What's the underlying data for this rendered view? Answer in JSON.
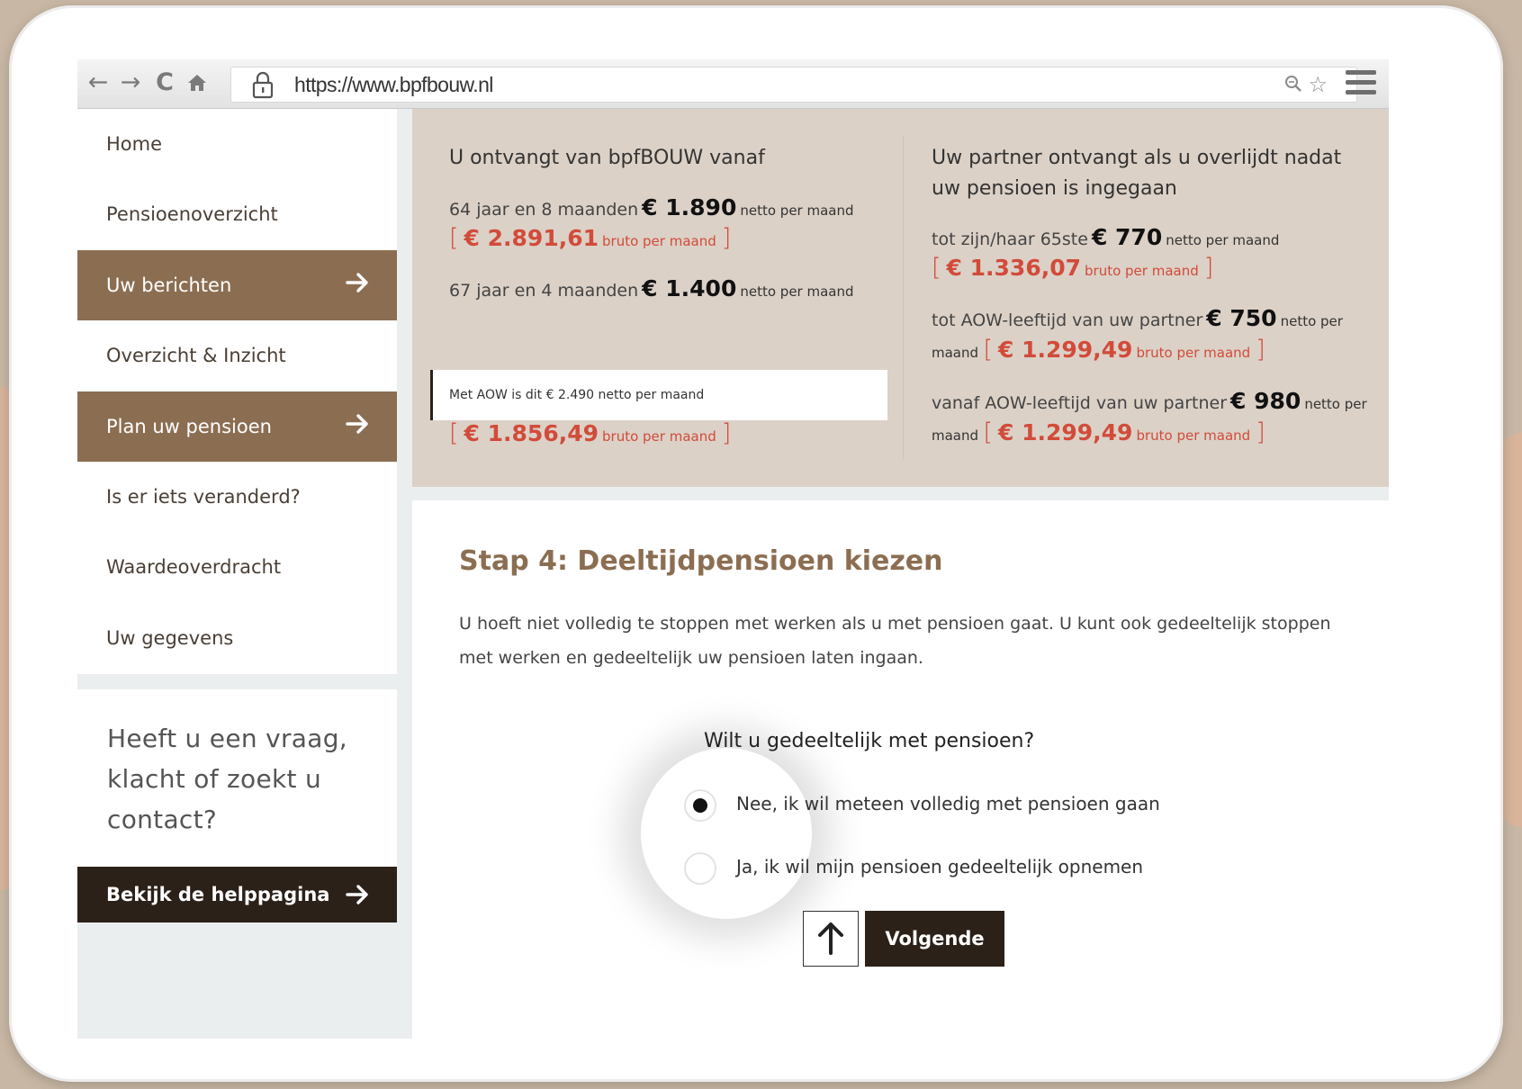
{
  "browser": {
    "url": "https://www.bpfbouw.nl"
  },
  "sidebar": {
    "items": [
      {
        "label": "Home",
        "active": false
      },
      {
        "label": "Pensioenoverzicht",
        "active": false
      },
      {
        "label": "Uw berichten",
        "active": true
      },
      {
        "label": "Overzicht & Inzicht",
        "active": false
      },
      {
        "label": "Plan uw pensioen",
        "active": true
      },
      {
        "label": "Is er iets veranderd?",
        "active": false
      },
      {
        "label": "Waardeoverdracht",
        "active": false
      },
      {
        "label": "Uw gegevens",
        "active": false
      }
    ],
    "help": {
      "text": "Heeft u een vraag, klacht of zoekt u contact?",
      "button_label": "Bekijk de helppagina"
    }
  },
  "summary": {
    "left": {
      "title": "U ontvangt van bpfBOUW vanaf",
      "row1": {
        "prefix": "64 jaar en 8 maanden",
        "amount": "€ 1.890",
        "suffix": "netto per maand",
        "bruto": "€ 2.891,61",
        "bruto_suffix": "bruto per maand"
      },
      "row2": {
        "prefix": "67 jaar en 4 maanden",
        "amount": "€ 1.400",
        "suffix": "netto per maand"
      },
      "aow_note": "Met AOW is dit  € 2.490 netto per maand",
      "row2_bruto": {
        "bruto": "€ 1.856,49",
        "bruto_suffix": "bruto per maand"
      }
    },
    "right": {
      "title": "Uw partner ontvangt als u overlijdt nadat uw pensioen is ingegaan",
      "row1": {
        "prefix": "tot zijn/haar 65ste",
        "amount": "€ 770",
        "suffix": "netto per maand",
        "bruto": "€ 1.336,07",
        "bruto_suffix": "bruto per maand"
      },
      "row2": {
        "prefix": "tot AOW-leeftijd van uw partner",
        "amount": "€ 750",
        "suffix": "netto per",
        "suffix2": "maand",
        "bruto": "€ 1.299,49",
        "bruto_suffix": "bruto per maand"
      },
      "row3": {
        "prefix": "vanaf AOW-leeftijd van uw partner",
        "amount": "€ 980",
        "suffix": "netto per",
        "suffix2": "maand",
        "bruto": "€ 1.299,49",
        "bruto_suffix": "bruto per maand"
      }
    },
    "bracket_open": "[",
    "bracket_close": "]"
  },
  "main": {
    "step_title": "Stap 4: Deeltijdpensioen kiezen",
    "step_desc": "U hoeft niet volledig te stoppen met werken als u met pensioen gaat. U kunt ook gedeeltelijk stoppen met werken en gedeeltelijk uw pensioen laten ingaan.",
    "question": "Wilt u gedeeltelijk met pensioen?",
    "options": [
      {
        "label": "Nee, ik wil meteen volledig met pensioen gaan",
        "checked": true
      },
      {
        "label": "Ja, ik wil mijn pensioen gedeeltelijk opnemen",
        "checked": false
      }
    ],
    "next_label": "Volgende"
  },
  "colors": {
    "brand_brown": "#8b6e52",
    "dark": "#2b2119",
    "bruto_red": "#d24b3a",
    "summary_bg": "#dbd1c7"
  }
}
